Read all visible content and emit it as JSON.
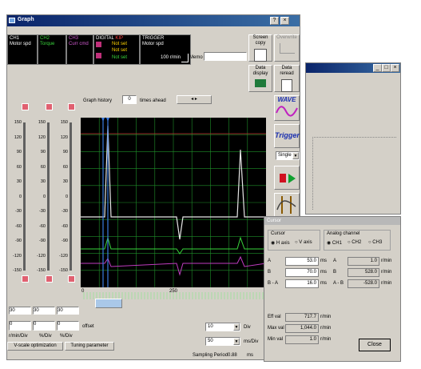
{
  "window": {
    "title": "Graph"
  },
  "channels": [
    {
      "id": "CH1",
      "label": "Motor spd",
      "color": "#ffffff"
    },
    {
      "id": "CH2",
      "label": "Torque",
      "color": "#39d63c"
    },
    {
      "id": "CH3",
      "label": "Curr cmd",
      "color": "#d05ad0"
    }
  ],
  "digital": {
    "title": "DIGITAL",
    "sub": "KIP",
    "rows": [
      "Not set",
      "Not set",
      "Not set"
    ]
  },
  "trigger": {
    "title": "TRIGGER",
    "source": "Motor spd",
    "value": "100 r/min"
  },
  "memo": {
    "label": "Memo"
  },
  "toolbar": {
    "screen_copy": "Screen copy",
    "overwrite": "Overwrite",
    "data_display": "Data display",
    "data_reread": "Data reread",
    "wave": "WAVE",
    "trigger": "Trigger",
    "mode": "Single"
  },
  "history": {
    "label": "Graph history",
    "value": "0",
    "suffix": "times ahead"
  },
  "scale_ticks": [
    "150",
    "120",
    "90",
    "60",
    "30",
    "0",
    "-30",
    "-60",
    "-90",
    "-120",
    "-150"
  ],
  "xaxis": {
    "start": "0",
    "mid": "250"
  },
  "left_controls": {
    "dropdowns": [
      "30",
      "30",
      "30"
    ],
    "values": [
      "0",
      "0",
      "0"
    ],
    "offset_label": "offset",
    "units": [
      "r/min/Div",
      "%/Div",
      "%/Div"
    ]
  },
  "tabs": {
    "vscale": "V-scale optimization",
    "tuning": "Tuning parameter"
  },
  "bottom": {
    "div_value": "10",
    "div_label": "Div",
    "ms_value": "50",
    "ms_label": "ms/Div",
    "sampling": "Sampling Period",
    "sampling_value": "0.88",
    "sampling_unit": "ms"
  },
  "cursor_panel": {
    "title": "Cursor",
    "cursor_label": "Cursor",
    "h_axis": "H axis",
    "v_axis": "V axis",
    "analog_label": "Analog channel",
    "analog_options": [
      "CH1",
      "CH2",
      "CH3"
    ],
    "rows": [
      {
        "a": "A",
        "v1": "53.0",
        "u1": "ms",
        "b": "A",
        "v2": "1.0",
        "u2": "r/min"
      },
      {
        "a": "B",
        "v1": "70.0",
        "u1": "ms",
        "b": "B",
        "v2": "528.0",
        "u2": "r/min"
      },
      {
        "a": "B - A",
        "v1": "16.0",
        "u1": "ms",
        "b": "A - B",
        "v2": "-528.0",
        "u2": "r/min"
      }
    ],
    "stats": [
      {
        "label": "Eff val",
        "value": "717.7",
        "unit": "r/min"
      },
      {
        "label": "Max val",
        "value": "1,044.0",
        "unit": "r/min"
      },
      {
        "label": "Min val",
        "value": "1.0",
        "unit": "r/min"
      }
    ],
    "close": "Close"
  },
  "colors": {
    "window": "#d4d0c8",
    "plot_bg": "#000000",
    "grid": "#1f8f2a",
    "accent": "#0a246a",
    "trace_white": "#e6e6e6",
    "trace_green": "#39d63c",
    "trace_magenta": "#c03cc0"
  }
}
